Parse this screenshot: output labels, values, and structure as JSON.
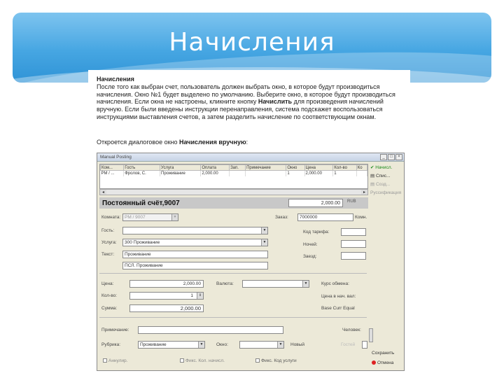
{
  "slide": {
    "title": "Начисления"
  },
  "doc": {
    "heading": "Начисления",
    "paragraph_1a": "После того как выбран счет, пользователь должен выбрать окно, в которое будут производиться начисления. Окно №1 будет выделено по умолчанию. Выберите окно, в которое будут производиться начисления. Если окна не настроены, кликните кнопку ",
    "bold_button": "Начислить",
    "paragraph_1b": " для произведения начислений вручную. Если были введены инструкции перенаправления, система подскажет воспользоваться инструкциями выставления счетов, а затем разделить начисление по соответствующим окнам.",
    "caption_prefix": "Откроется диалоговое окно ",
    "caption_bold": "Начисления вручную",
    "caption_suffix": ":"
  },
  "window": {
    "title": "Manual Posting",
    "btn_min": "_",
    "btn_max": "□",
    "btn_close": "×",
    "grid": {
      "columns": [
        "Ком...",
        "Гость",
        "Услуга",
        "Оплата",
        "Зап.",
        "Примечание",
        "Окно",
        "Цена",
        "Кол-во",
        "Ко"
      ],
      "row": [
        "PM / ...",
        "Фролов, С.",
        "Проживание",
        "2,000.00",
        "",
        "",
        "1",
        "2,000.00",
        "1",
        ""
      ]
    },
    "scroll_left": "◂",
    "scroll_right": "▸",
    "side_buttons": {
      "post": "Начисл.",
      "list": "Спис...",
      "dup": "Созд...",
      "edit": "Руссификация"
    },
    "account": {
      "title": "Постоянный счёт,9007",
      "amount": "2,000.00",
      "unit": "RUB"
    },
    "labels": {
      "account": "Комната:",
      "guest": "Гость:",
      "service": "Услуга:",
      "text": "Текст:",
      "order": "Заказ:",
      "room": "Комн.",
      "tariff_code": "Код тарифа:",
      "nights": "Ночей:",
      "stay": "Заезд:",
      "price": "Цена:",
      "qty": "Кол-во:",
      "sum": "Сумма:",
      "currency": "Валюта:",
      "rate": "Курс обмена:",
      "price_home": "Цена в нач. вал:",
      "base_price": "Base Curr Equal",
      "note": "Примечание:",
      "people": "Человек:",
      "category": "Рубрика:",
      "window": "Окно:",
      "new": "Новый",
      "guests_label": "Гостей"
    },
    "values": {
      "account": "PM / 9007",
      "order": "7000000",
      "service": "300  Проживание",
      "text_1": "Проживание",
      "text_2": "ПСЛ. Проживание",
      "price": "2,000.00",
      "qty": "1",
      "sum": "2,000.00",
      "category": "Проживание",
      "window": ""
    },
    "checks": {
      "c1": "Аннулир.",
      "c2": "Фикс. Кол. начисл.",
      "c3": "Фикс. Код услуги"
    },
    "save": "Сохранить",
    "cancel": "Отмена"
  }
}
